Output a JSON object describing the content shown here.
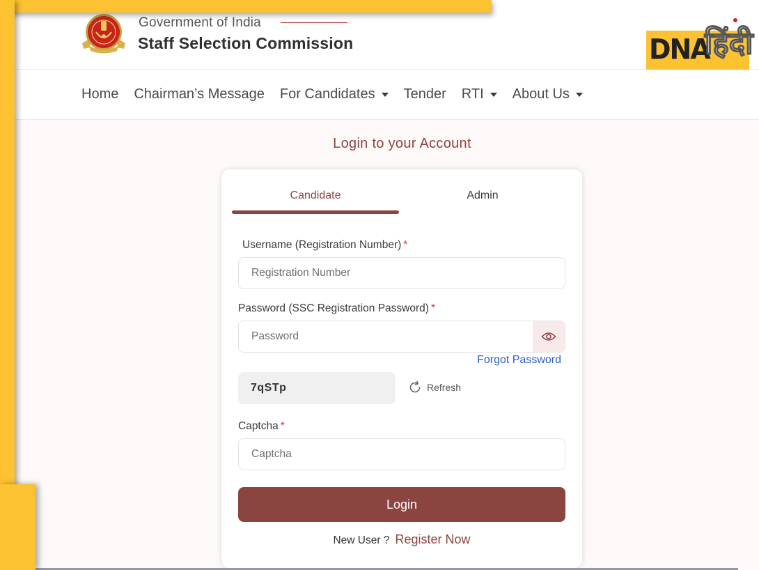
{
  "header": {
    "org_subtitle": "Government of India",
    "org_title": "Staff Selection Commission",
    "watermark": {
      "latin": "DNA",
      "hindi": "हिंदी"
    }
  },
  "nav": {
    "items": [
      {
        "label": "Home",
        "dropdown": false
      },
      {
        "label": "Chairman’s Message",
        "dropdown": false
      },
      {
        "label": "For Candidates",
        "dropdown": true
      },
      {
        "label": "Tender",
        "dropdown": false
      },
      {
        "label": "RTI",
        "dropdown": true
      },
      {
        "label": "About Us",
        "dropdown": true
      }
    ]
  },
  "login": {
    "title": "Login to your Account",
    "tabs": [
      {
        "label": "Candidate",
        "active": true
      },
      {
        "label": "Admin",
        "active": false
      }
    ],
    "username": {
      "label": "Username (Registration Number)",
      "required_mark": "*",
      "placeholder": "Registration Number",
      "value": ""
    },
    "password": {
      "label": "Password (SSC Registration Password)",
      "required_mark": "*",
      "placeholder": "Password",
      "value": "",
      "toggle_icon": "eye-icon"
    },
    "forgot_password": "Forgot Password",
    "captcha": {
      "code": "7qSTp",
      "refresh_label": "Refresh",
      "refresh_icon": "refresh-icon",
      "label": "Captcha",
      "required_mark": "*",
      "placeholder": "Captcha",
      "value": ""
    },
    "submit_label": "Login",
    "new_user_text": "New User ?",
    "register_label": "Register Now"
  },
  "colors": {
    "primary": "#8b4540",
    "link": "#2c5fc9",
    "required": "#e03131",
    "frame": "#fdc232"
  }
}
